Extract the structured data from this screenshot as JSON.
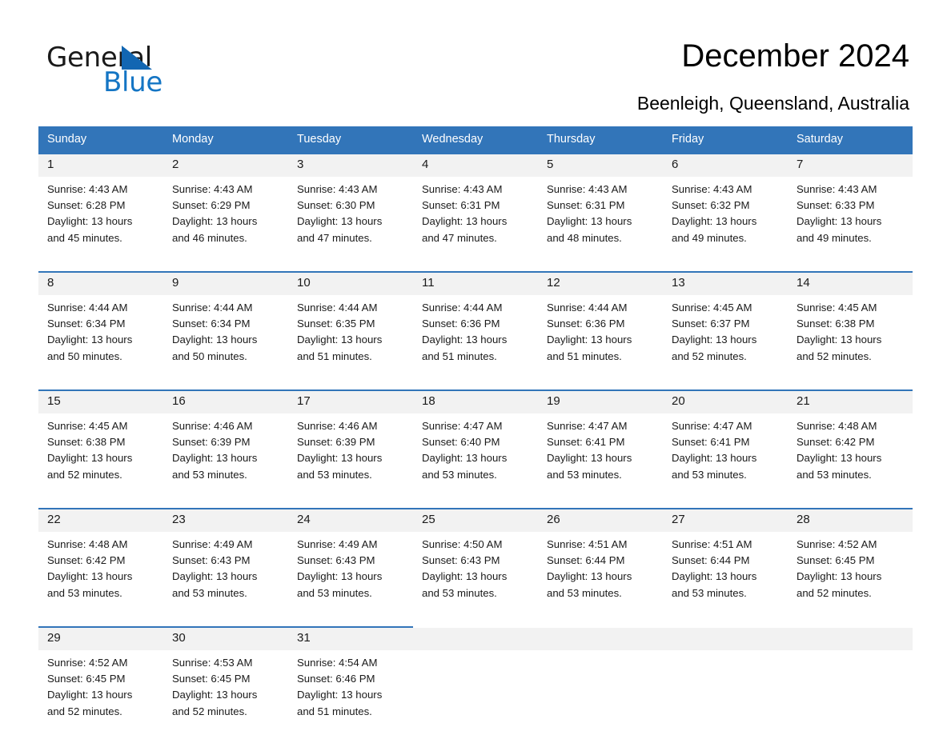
{
  "brand": {
    "word_one": "General",
    "word_two": "Blue",
    "triangle_color": "#1266b2",
    "blue_text_color": "#1475c4"
  },
  "header": {
    "title": "December 2024",
    "subtitle": "Beenleigh, Queensland, Australia"
  },
  "theme": {
    "header_row_bg": "#3275b9",
    "daynum_bg": "#f2f2f2",
    "row_rule": "#3275b9",
    "text": "#1a1a1a"
  },
  "weekdays": [
    "Sunday",
    "Monday",
    "Tuesday",
    "Wednesday",
    "Thursday",
    "Friday",
    "Saturday"
  ],
  "weeks": [
    {
      "days": [
        {
          "num": "1",
          "sunrise": "Sunrise: 4:43 AM",
          "sunset": "Sunset: 6:28 PM",
          "daylight1": "Daylight: 13 hours",
          "daylight2": "and 45 minutes."
        },
        {
          "num": "2",
          "sunrise": "Sunrise: 4:43 AM",
          "sunset": "Sunset: 6:29 PM",
          "daylight1": "Daylight: 13 hours",
          "daylight2": "and 46 minutes."
        },
        {
          "num": "3",
          "sunrise": "Sunrise: 4:43 AM",
          "sunset": "Sunset: 6:30 PM",
          "daylight1": "Daylight: 13 hours",
          "daylight2": "and 47 minutes."
        },
        {
          "num": "4",
          "sunrise": "Sunrise: 4:43 AM",
          "sunset": "Sunset: 6:31 PM",
          "daylight1": "Daylight: 13 hours",
          "daylight2": "and 47 minutes."
        },
        {
          "num": "5",
          "sunrise": "Sunrise: 4:43 AM",
          "sunset": "Sunset: 6:31 PM",
          "daylight1": "Daylight: 13 hours",
          "daylight2": "and 48 minutes."
        },
        {
          "num": "6",
          "sunrise": "Sunrise: 4:43 AM",
          "sunset": "Sunset: 6:32 PM",
          "daylight1": "Daylight: 13 hours",
          "daylight2": "and 49 minutes."
        },
        {
          "num": "7",
          "sunrise": "Sunrise: 4:43 AM",
          "sunset": "Sunset: 6:33 PM",
          "daylight1": "Daylight: 13 hours",
          "daylight2": "and 49 minutes."
        }
      ]
    },
    {
      "days": [
        {
          "num": "8",
          "sunrise": "Sunrise: 4:44 AM",
          "sunset": "Sunset: 6:34 PM",
          "daylight1": "Daylight: 13 hours",
          "daylight2": "and 50 minutes."
        },
        {
          "num": "9",
          "sunrise": "Sunrise: 4:44 AM",
          "sunset": "Sunset: 6:34 PM",
          "daylight1": "Daylight: 13 hours",
          "daylight2": "and 50 minutes."
        },
        {
          "num": "10",
          "sunrise": "Sunrise: 4:44 AM",
          "sunset": "Sunset: 6:35 PM",
          "daylight1": "Daylight: 13 hours",
          "daylight2": "and 51 minutes."
        },
        {
          "num": "11",
          "sunrise": "Sunrise: 4:44 AM",
          "sunset": "Sunset: 6:36 PM",
          "daylight1": "Daylight: 13 hours",
          "daylight2": "and 51 minutes."
        },
        {
          "num": "12",
          "sunrise": "Sunrise: 4:44 AM",
          "sunset": "Sunset: 6:36 PM",
          "daylight1": "Daylight: 13 hours",
          "daylight2": "and 51 minutes."
        },
        {
          "num": "13",
          "sunrise": "Sunrise: 4:45 AM",
          "sunset": "Sunset: 6:37 PM",
          "daylight1": "Daylight: 13 hours",
          "daylight2": "and 52 minutes."
        },
        {
          "num": "14",
          "sunrise": "Sunrise: 4:45 AM",
          "sunset": "Sunset: 6:38 PM",
          "daylight1": "Daylight: 13 hours",
          "daylight2": "and 52 minutes."
        }
      ]
    },
    {
      "days": [
        {
          "num": "15",
          "sunrise": "Sunrise: 4:45 AM",
          "sunset": "Sunset: 6:38 PM",
          "daylight1": "Daylight: 13 hours",
          "daylight2": "and 52 minutes."
        },
        {
          "num": "16",
          "sunrise": "Sunrise: 4:46 AM",
          "sunset": "Sunset: 6:39 PM",
          "daylight1": "Daylight: 13 hours",
          "daylight2": "and 53 minutes."
        },
        {
          "num": "17",
          "sunrise": "Sunrise: 4:46 AM",
          "sunset": "Sunset: 6:39 PM",
          "daylight1": "Daylight: 13 hours",
          "daylight2": "and 53 minutes."
        },
        {
          "num": "18",
          "sunrise": "Sunrise: 4:47 AM",
          "sunset": "Sunset: 6:40 PM",
          "daylight1": "Daylight: 13 hours",
          "daylight2": "and 53 minutes."
        },
        {
          "num": "19",
          "sunrise": "Sunrise: 4:47 AM",
          "sunset": "Sunset: 6:41 PM",
          "daylight1": "Daylight: 13 hours",
          "daylight2": "and 53 minutes."
        },
        {
          "num": "20",
          "sunrise": "Sunrise: 4:47 AM",
          "sunset": "Sunset: 6:41 PM",
          "daylight1": "Daylight: 13 hours",
          "daylight2": "and 53 minutes."
        },
        {
          "num": "21",
          "sunrise": "Sunrise: 4:48 AM",
          "sunset": "Sunset: 6:42 PM",
          "daylight1": "Daylight: 13 hours",
          "daylight2": "and 53 minutes."
        }
      ]
    },
    {
      "days": [
        {
          "num": "22",
          "sunrise": "Sunrise: 4:48 AM",
          "sunset": "Sunset: 6:42 PM",
          "daylight1": "Daylight: 13 hours",
          "daylight2": "and 53 minutes."
        },
        {
          "num": "23",
          "sunrise": "Sunrise: 4:49 AM",
          "sunset": "Sunset: 6:43 PM",
          "daylight1": "Daylight: 13 hours",
          "daylight2": "and 53 minutes."
        },
        {
          "num": "24",
          "sunrise": "Sunrise: 4:49 AM",
          "sunset": "Sunset: 6:43 PM",
          "daylight1": "Daylight: 13 hours",
          "daylight2": "and 53 minutes."
        },
        {
          "num": "25",
          "sunrise": "Sunrise: 4:50 AM",
          "sunset": "Sunset: 6:43 PM",
          "daylight1": "Daylight: 13 hours",
          "daylight2": "and 53 minutes."
        },
        {
          "num": "26",
          "sunrise": "Sunrise: 4:51 AM",
          "sunset": "Sunset: 6:44 PM",
          "daylight1": "Daylight: 13 hours",
          "daylight2": "and 53 minutes."
        },
        {
          "num": "27",
          "sunrise": "Sunrise: 4:51 AM",
          "sunset": "Sunset: 6:44 PM",
          "daylight1": "Daylight: 13 hours",
          "daylight2": "and 53 minutes."
        },
        {
          "num": "28",
          "sunrise": "Sunrise: 4:52 AM",
          "sunset": "Sunset: 6:45 PM",
          "daylight1": "Daylight: 13 hours",
          "daylight2": "and 52 minutes."
        }
      ]
    },
    {
      "days": [
        {
          "num": "29",
          "sunrise": "Sunrise: 4:52 AM",
          "sunset": "Sunset: 6:45 PM",
          "daylight1": "Daylight: 13 hours",
          "daylight2": "and 52 minutes."
        },
        {
          "num": "30",
          "sunrise": "Sunrise: 4:53 AM",
          "sunset": "Sunset: 6:45 PM",
          "daylight1": "Daylight: 13 hours",
          "daylight2": "and 52 minutes."
        },
        {
          "num": "31",
          "sunrise": "Sunrise: 4:54 AM",
          "sunset": "Sunset: 6:46 PM",
          "daylight1": "Daylight: 13 hours",
          "daylight2": "and 51 minutes."
        },
        {
          "num": "",
          "sunrise": "",
          "sunset": "",
          "daylight1": "",
          "daylight2": ""
        },
        {
          "num": "",
          "sunrise": "",
          "sunset": "",
          "daylight1": "",
          "daylight2": ""
        },
        {
          "num": "",
          "sunrise": "",
          "sunset": "",
          "daylight1": "",
          "daylight2": ""
        },
        {
          "num": "",
          "sunrise": "",
          "sunset": "",
          "daylight1": "",
          "daylight2": ""
        }
      ]
    }
  ]
}
